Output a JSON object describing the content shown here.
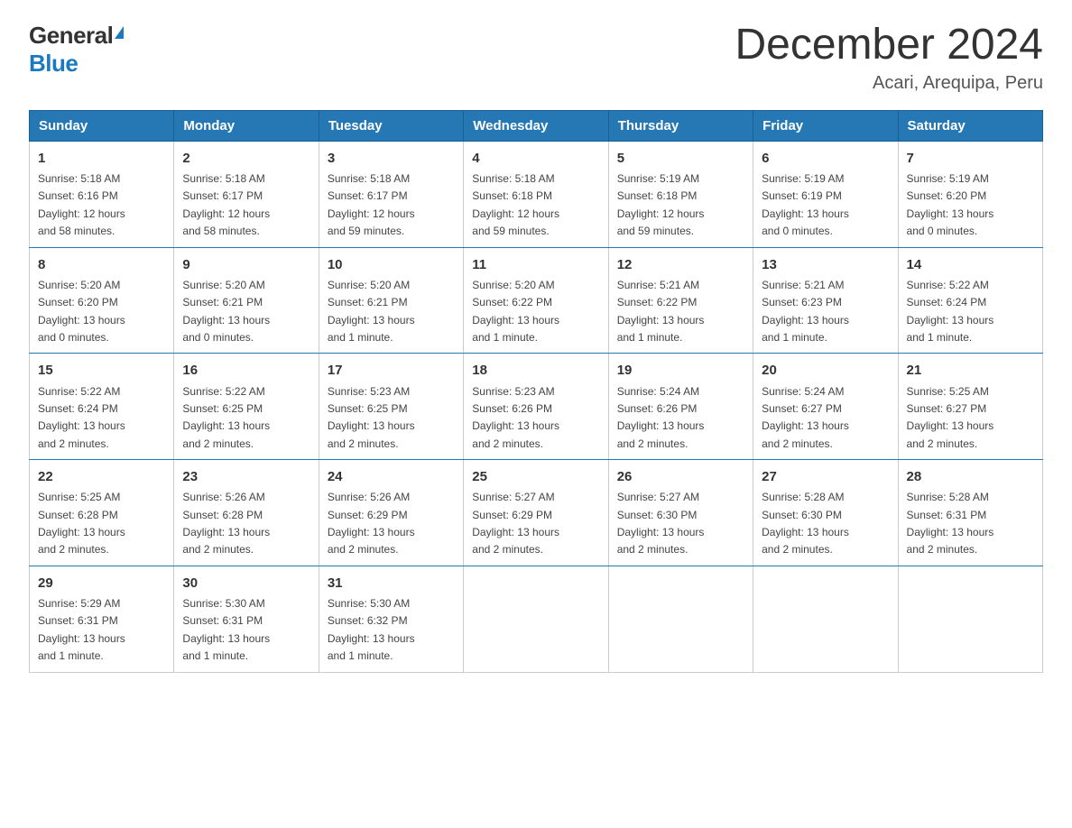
{
  "logo": {
    "general": "General",
    "blue": "Blue"
  },
  "title": "December 2024",
  "subtitle": "Acari, Arequipa, Peru",
  "weekdays": [
    "Sunday",
    "Monday",
    "Tuesday",
    "Wednesday",
    "Thursday",
    "Friday",
    "Saturday"
  ],
  "weeks": [
    [
      {
        "day": "1",
        "sunrise": "5:18 AM",
        "sunset": "6:16 PM",
        "daylight_hours": "12",
        "daylight_minutes": "58"
      },
      {
        "day": "2",
        "sunrise": "5:18 AM",
        "sunset": "6:17 PM",
        "daylight_hours": "12",
        "daylight_minutes": "58"
      },
      {
        "day": "3",
        "sunrise": "5:18 AM",
        "sunset": "6:17 PM",
        "daylight_hours": "12",
        "daylight_minutes": "59"
      },
      {
        "day": "4",
        "sunrise": "5:18 AM",
        "sunset": "6:18 PM",
        "daylight_hours": "12",
        "daylight_minutes": "59"
      },
      {
        "day": "5",
        "sunrise": "5:19 AM",
        "sunset": "6:18 PM",
        "daylight_hours": "12",
        "daylight_minutes": "59"
      },
      {
        "day": "6",
        "sunrise": "5:19 AM",
        "sunset": "6:19 PM",
        "daylight_hours": "13",
        "daylight_minutes": "0"
      },
      {
        "day": "7",
        "sunrise": "5:19 AM",
        "sunset": "6:20 PM",
        "daylight_hours": "13",
        "daylight_minutes": "0"
      }
    ],
    [
      {
        "day": "8",
        "sunrise": "5:20 AM",
        "sunset": "6:20 PM",
        "daylight_hours": "13",
        "daylight_minutes": "0"
      },
      {
        "day": "9",
        "sunrise": "5:20 AM",
        "sunset": "6:21 PM",
        "daylight_hours": "13",
        "daylight_minutes": "0"
      },
      {
        "day": "10",
        "sunrise": "5:20 AM",
        "sunset": "6:21 PM",
        "daylight_hours": "13",
        "daylight_minutes": "1"
      },
      {
        "day": "11",
        "sunrise": "5:20 AM",
        "sunset": "6:22 PM",
        "daylight_hours": "13",
        "daylight_minutes": "1"
      },
      {
        "day": "12",
        "sunrise": "5:21 AM",
        "sunset": "6:22 PM",
        "daylight_hours": "13",
        "daylight_minutes": "1"
      },
      {
        "day": "13",
        "sunrise": "5:21 AM",
        "sunset": "6:23 PM",
        "daylight_hours": "13",
        "daylight_minutes": "1"
      },
      {
        "day": "14",
        "sunrise": "5:22 AM",
        "sunset": "6:24 PM",
        "daylight_hours": "13",
        "daylight_minutes": "1"
      }
    ],
    [
      {
        "day": "15",
        "sunrise": "5:22 AM",
        "sunset": "6:24 PM",
        "daylight_hours": "13",
        "daylight_minutes": "2"
      },
      {
        "day": "16",
        "sunrise": "5:22 AM",
        "sunset": "6:25 PM",
        "daylight_hours": "13",
        "daylight_minutes": "2"
      },
      {
        "day": "17",
        "sunrise": "5:23 AM",
        "sunset": "6:25 PM",
        "daylight_hours": "13",
        "daylight_minutes": "2"
      },
      {
        "day": "18",
        "sunrise": "5:23 AM",
        "sunset": "6:26 PM",
        "daylight_hours": "13",
        "daylight_minutes": "2"
      },
      {
        "day": "19",
        "sunrise": "5:24 AM",
        "sunset": "6:26 PM",
        "daylight_hours": "13",
        "daylight_minutes": "2"
      },
      {
        "day": "20",
        "sunrise": "5:24 AM",
        "sunset": "6:27 PM",
        "daylight_hours": "13",
        "daylight_minutes": "2"
      },
      {
        "day": "21",
        "sunrise": "5:25 AM",
        "sunset": "6:27 PM",
        "daylight_hours": "13",
        "daylight_minutes": "2"
      }
    ],
    [
      {
        "day": "22",
        "sunrise": "5:25 AM",
        "sunset": "6:28 PM",
        "daylight_hours": "13",
        "daylight_minutes": "2"
      },
      {
        "day": "23",
        "sunrise": "5:26 AM",
        "sunset": "6:28 PM",
        "daylight_hours": "13",
        "daylight_minutes": "2"
      },
      {
        "day": "24",
        "sunrise": "5:26 AM",
        "sunset": "6:29 PM",
        "daylight_hours": "13",
        "daylight_minutes": "2"
      },
      {
        "day": "25",
        "sunrise": "5:27 AM",
        "sunset": "6:29 PM",
        "daylight_hours": "13",
        "daylight_minutes": "2"
      },
      {
        "day": "26",
        "sunrise": "5:27 AM",
        "sunset": "6:30 PM",
        "daylight_hours": "13",
        "daylight_minutes": "2"
      },
      {
        "day": "27",
        "sunrise": "5:28 AM",
        "sunset": "6:30 PM",
        "daylight_hours": "13",
        "daylight_minutes": "2"
      },
      {
        "day": "28",
        "sunrise": "5:28 AM",
        "sunset": "6:31 PM",
        "daylight_hours": "13",
        "daylight_minutes": "2"
      }
    ],
    [
      {
        "day": "29",
        "sunrise": "5:29 AM",
        "sunset": "6:31 PM",
        "daylight_hours": "13",
        "daylight_minutes": "1"
      },
      {
        "day": "30",
        "sunrise": "5:30 AM",
        "sunset": "6:31 PM",
        "daylight_hours": "13",
        "daylight_minutes": "1"
      },
      {
        "day": "31",
        "sunrise": "5:30 AM",
        "sunset": "6:32 PM",
        "daylight_hours": "13",
        "daylight_minutes": "1"
      },
      null,
      null,
      null,
      null
    ]
  ],
  "labels": {
    "sunrise": "Sunrise:",
    "sunset": "Sunset:",
    "daylight": "Daylight:",
    "hours": "hours",
    "and": "and",
    "minutes": "minutes.",
    "minute": "minute."
  }
}
